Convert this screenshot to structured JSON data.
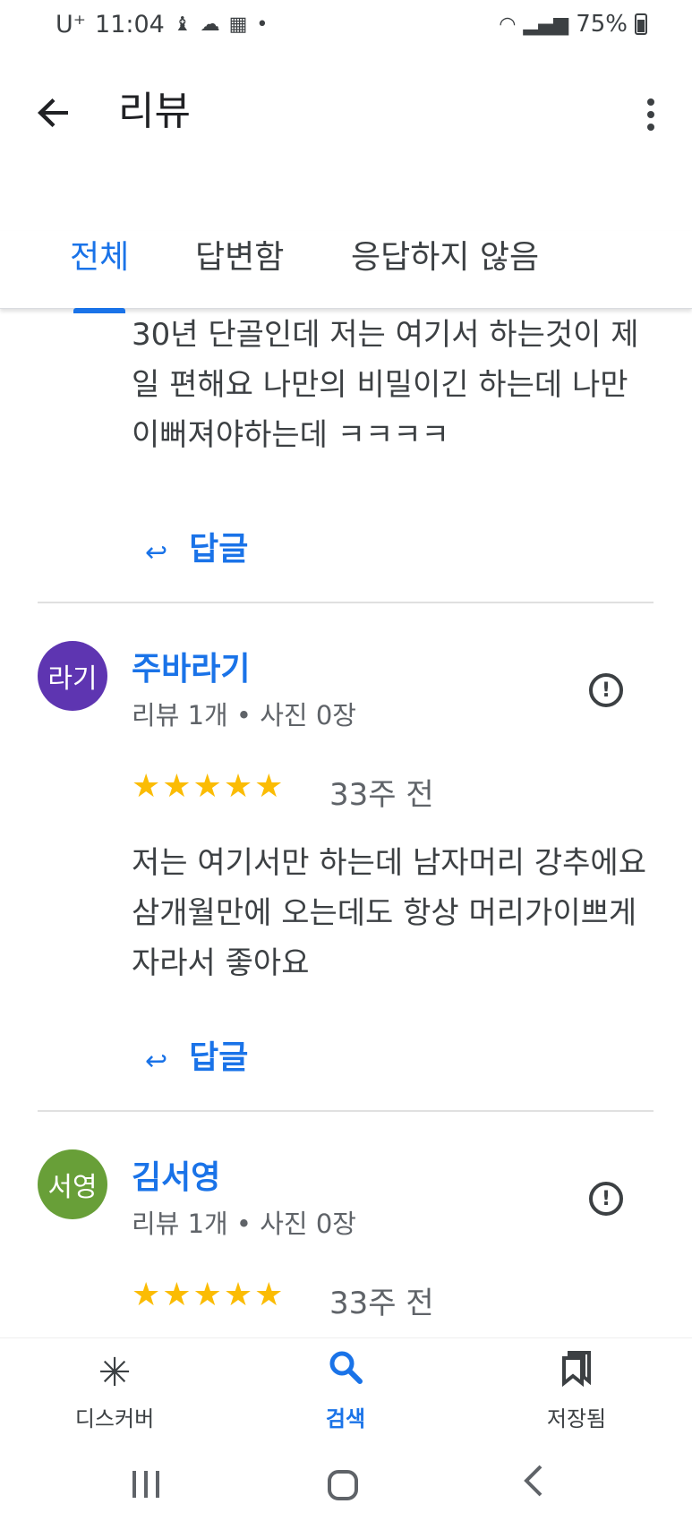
{
  "status_bar": {
    "carrier": "U⁺",
    "time": "11:04",
    "battery": "75%"
  },
  "app_bar": {
    "title": "리뷰"
  },
  "tabs": [
    {
      "label": "전체",
      "active": true
    },
    {
      "label": "답변함",
      "active": false
    },
    {
      "label": "응답하지 않음",
      "active": false
    }
  ],
  "reviews": [
    {
      "text": "30년 단골인데 저는 여기서 하는것이 제일 편해요 나만의 비밀이긴 하는데 나만 이뻐져야하는데 ㅋㅋㅋㅋ",
      "reply_label": "답글"
    },
    {
      "avatar_text": "라기",
      "avatar_color": "#5e35b1",
      "name": "주바라기",
      "meta": "리뷰 1개 • 사진 0장",
      "stars": "★★★★★",
      "rating": 5,
      "age": "33주 전",
      "text": "저는 여기서만 하는데 남자머리 강추에요삼개월만에 오는데도 항상 머리가이쁘게자라서 좋아요",
      "reply_label": "답글"
    },
    {
      "avatar_text": "서영",
      "avatar_color": "#689f38",
      "name": "김서영",
      "meta": "리뷰 1개 • 사진 0장",
      "stars": "★★★★★",
      "rating": 5,
      "age": "33주 전"
    }
  ],
  "bottom_nav": [
    {
      "label": "디스커버",
      "icon": "asterisk-icon",
      "active": false
    },
    {
      "label": "검색",
      "icon": "search-icon",
      "active": true
    },
    {
      "label": "저장됨",
      "icon": "bookmarks-icon",
      "active": false
    }
  ],
  "colors": {
    "accent": "#1a73e8",
    "star": "#fbbc04"
  }
}
